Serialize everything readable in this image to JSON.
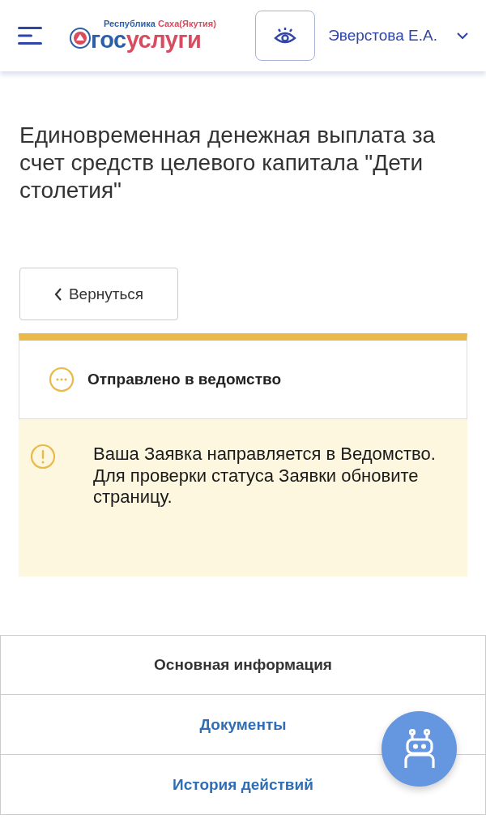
{
  "header": {
    "logo": {
      "region_first": "Республика",
      "region_second": "Саха(Якутия)",
      "brand_first": "гос",
      "brand_second": "услуги"
    },
    "user_name": "Эверстова Е.А."
  },
  "page_title": "Единовременная денежная выплата за счет средств целевого капитала \"Дети столетия\"",
  "back_button": "Вернуться",
  "status": {
    "label": "Отправлено в ведомство",
    "color": "#e9b949"
  },
  "notice": "Ваша Заявка направляется в Ведомство. Для проверки статуса Заявки обновите страницу.",
  "tabs": [
    {
      "label": "Основная информация",
      "selected": true
    },
    {
      "label": "Документы",
      "selected": false
    },
    {
      "label": "История действий",
      "selected": false
    }
  ]
}
